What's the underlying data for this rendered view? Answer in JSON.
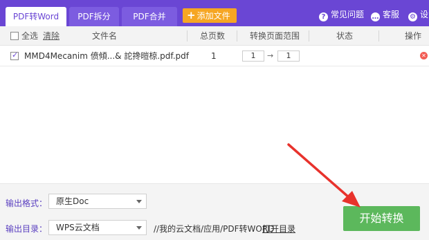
{
  "tabs": [
    {
      "label": "PDF转Word",
      "active": true
    },
    {
      "label": "PDF拆分",
      "active": false
    },
    {
      "label": "PDF合并",
      "active": false
    }
  ],
  "add_file_label": "添加文件",
  "top_links": [
    {
      "icon": "help-icon",
      "label": "常见问题"
    },
    {
      "icon": "chat-icon",
      "label": "客服"
    },
    {
      "icon": "gear-icon",
      "label": "设"
    }
  ],
  "table": {
    "select_all": "全选",
    "clear": "清除",
    "columns": [
      "文件名",
      "总页数",
      "转换页面范围",
      "状态",
      "操作"
    ],
    "rows": [
      {
        "checked": true,
        "filename": "MMD4Mecanim 偾傾...& 詑搀暟椋.pdf.pdf",
        "pages": "1",
        "range_from": "1",
        "range_to": "1",
        "status": ""
      }
    ]
  },
  "bottom": {
    "format_label": "输出格式：",
    "format_value": "原生Doc",
    "dir_label": "输出目录：",
    "dir_value": "WPS云文档",
    "path": "//我的云文档/应用/PDF转WORD",
    "open_dir": "打开目录",
    "start_button": "开始转换"
  },
  "colors": {
    "topbar": "#6a46d4",
    "add_button": "#f6a623",
    "start_button": "#5cb85c",
    "annotation_arrow": "#e8322c"
  }
}
